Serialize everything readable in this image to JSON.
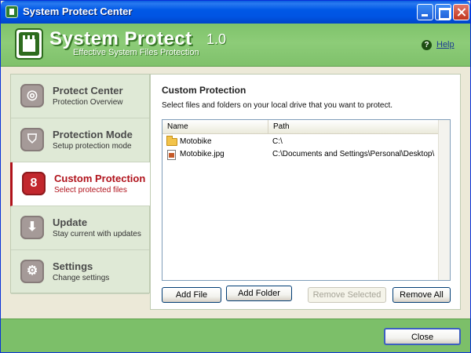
{
  "window": {
    "title": "System Protect Center"
  },
  "header": {
    "product_name": "System Protect",
    "version": "1.0",
    "tagline": "Effective System Files Protection",
    "help_label": "Help"
  },
  "sidebar": {
    "items": [
      {
        "title": "Protect Center",
        "subtitle": "Protection Overview",
        "icon": "target-icon",
        "glyph": "◎"
      },
      {
        "title": "Protection Mode",
        "subtitle": "Setup protection mode",
        "icon": "shield-icon",
        "glyph": "⛉"
      },
      {
        "title": "Custom Protection",
        "subtitle": "Select protected files",
        "icon": "custom-protection-icon",
        "glyph": "8",
        "active": true
      },
      {
        "title": "Update",
        "subtitle": "Stay current with updates",
        "icon": "download-arrow-icon",
        "glyph": "⬇"
      },
      {
        "title": "Settings",
        "subtitle": "Change settings",
        "icon": "gears-icon",
        "glyph": "⚙"
      }
    ]
  },
  "content": {
    "title": "Custom Protection",
    "description": "Select files and folders on your local drive that you want to protect.",
    "list": {
      "columns": [
        "Name",
        "Path"
      ],
      "rows": [
        {
          "name": "Motobike",
          "path": "C:\\",
          "type": "folder"
        },
        {
          "name": "Motobike.jpg",
          "path": "C:\\Documents and Settings\\Personal\\Desktop\\",
          "type": "file"
        }
      ]
    },
    "buttons": {
      "add_file": "Add File",
      "add_folder": "Add Folder",
      "remove_selected": "Remove Selected",
      "remove_all": "Remove All"
    }
  },
  "footer": {
    "close_label": "Close"
  },
  "colors": {
    "accent": "#b0121b",
    "banner_green": "#7fc36b",
    "titlebar_blue": "#0054e3"
  }
}
